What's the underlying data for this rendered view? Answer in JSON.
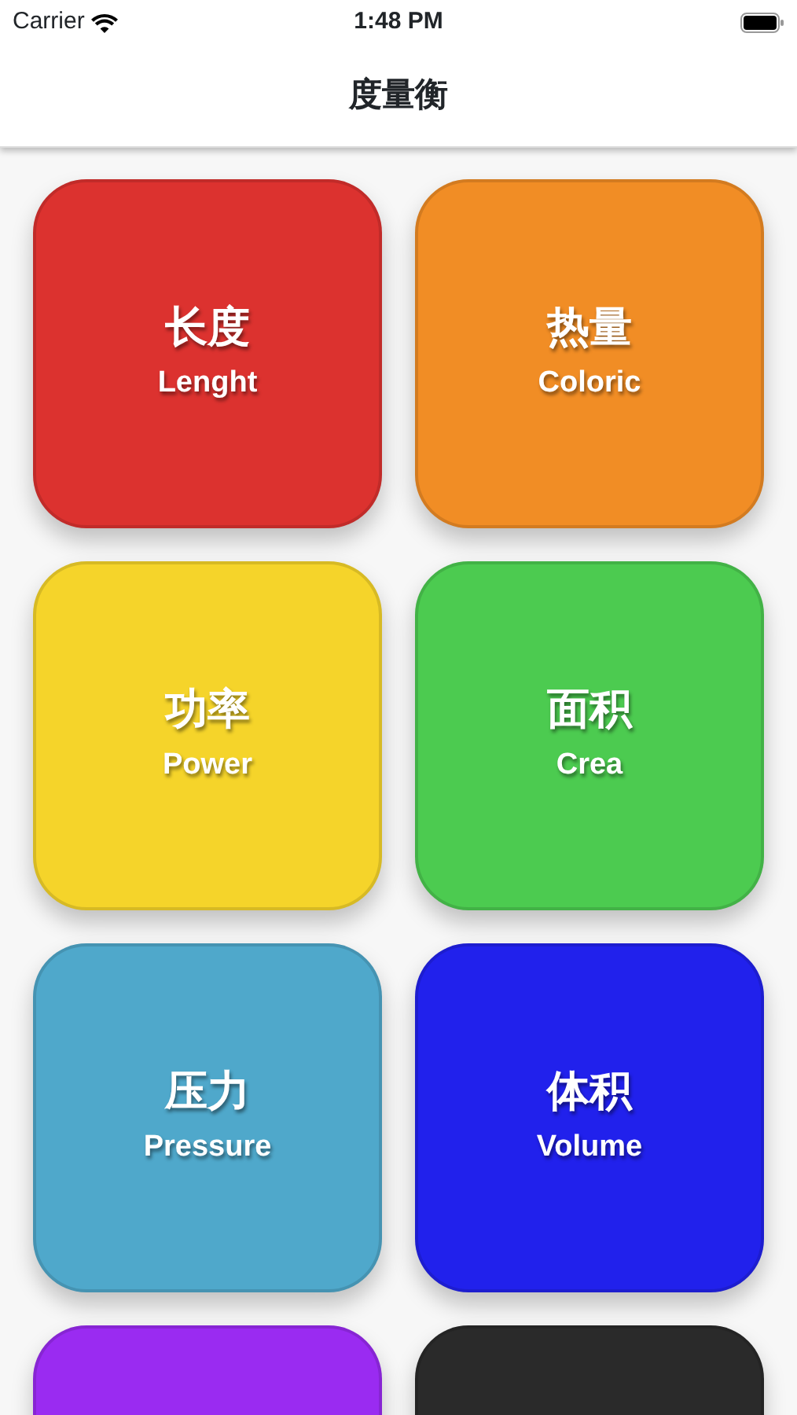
{
  "status_bar": {
    "carrier": "Carrier",
    "time": "1:48 PM"
  },
  "nav_bar": {
    "title": "度量衡"
  },
  "tiles": [
    {
      "title": "长度",
      "subtitle": "Lenght",
      "color": "#dc322f"
    },
    {
      "title": "热量",
      "subtitle": "Coloric",
      "color": "#f18d25"
    },
    {
      "title": "功率",
      "subtitle": "Power",
      "color": "#f5d42a"
    },
    {
      "title": "面积",
      "subtitle": "Crea",
      "color": "#4ccb50"
    },
    {
      "title": "压力",
      "subtitle": "Pressure",
      "color": "#4fa8cb"
    },
    {
      "title": "体积",
      "subtitle": "Volume",
      "color": "#2121ec"
    },
    {
      "color": "#9a2bf1"
    },
    {
      "color": "#2a2a2a"
    }
  ]
}
